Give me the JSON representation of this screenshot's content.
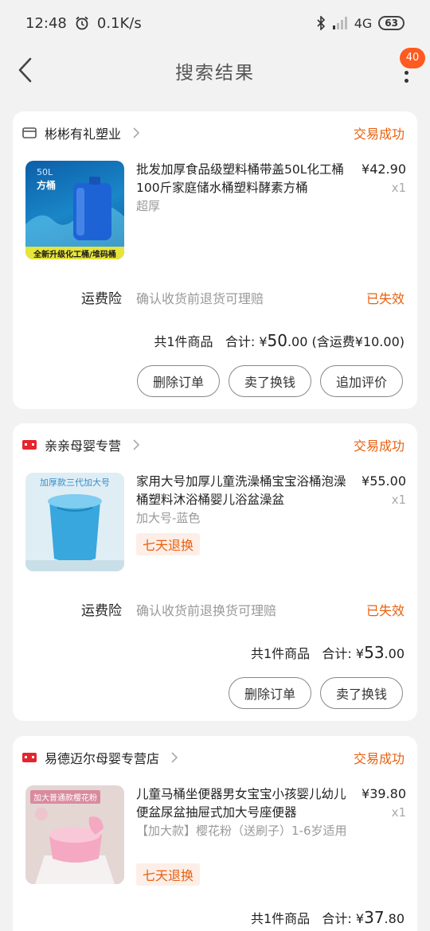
{
  "status_bar": {
    "time": "12:48",
    "net_speed": "0.1K/s",
    "network": "4G",
    "battery": "63"
  },
  "nav": {
    "title": "搜索结果",
    "badge": "40"
  },
  "orders": [
    {
      "shop": "彬彬有礼塑业",
      "status": "交易成功",
      "title": "批发加厚食品级塑料桶带盖50L化工桶100斤家庭储水桶塑料酵素方桶",
      "sku": "超厚",
      "price": "¥42.90",
      "qty": "x1",
      "thumb_text_1": "50L",
      "thumb_text_2": "方桶",
      "thumb_caption": "全新升级化工桶/堆码桶",
      "insurance_label": "运费险",
      "insurance_desc": "确认收货前退货可理赔",
      "insurance_status": "已失效",
      "summary_count": "共1件商品",
      "summary_label": "合计:",
      "summary_currency": "¥",
      "summary_int": "50",
      "summary_dec": ".00",
      "summary_extra": "(含运费¥10.00)",
      "buttons": [
        "删除订单",
        "卖了换钱",
        "追加评价"
      ]
    },
    {
      "shop": "亲亲母婴专营",
      "status": "交易成功",
      "title": "家用大号加厚儿童洗澡桶宝宝浴桶泡澡桶塑料沐浴桶婴儿浴盆澡盆",
      "sku": "加大号-蓝色",
      "tag": "七天退换",
      "price": "¥55.00",
      "qty": "x1",
      "thumb_text_1": "加厚款三代加大号",
      "insurance_label": "运费险",
      "insurance_desc": "确认收货前退换货可理赔",
      "insurance_status": "已失效",
      "summary_count": "共1件商品",
      "summary_label": "合计:",
      "summary_currency": "¥",
      "summary_int": "53",
      "summary_dec": ".00",
      "buttons": [
        "删除订单",
        "卖了换钱"
      ]
    },
    {
      "shop": "易德迈尔母婴专营店",
      "status": "交易成功",
      "title": "儿童马桶坐便器男女宝宝小孩婴儿幼儿便盆尿盆抽屉式加大号座便器",
      "sku": "【加大款】樱花粉（送刷子）1-6岁适用",
      "tag": "七天退换",
      "price": "¥39.80",
      "qty": "x1",
      "thumb_text_1": "加大普通款樱花粉",
      "summary_count": "共1件商品",
      "summary_label": "合计:",
      "summary_currency": "¥",
      "summary_int": "37",
      "summary_dec": ".80"
    }
  ],
  "colors": {
    "accent": "#e8600e",
    "badge": "#ff5a1f",
    "tmall_red": "#e6242d"
  }
}
